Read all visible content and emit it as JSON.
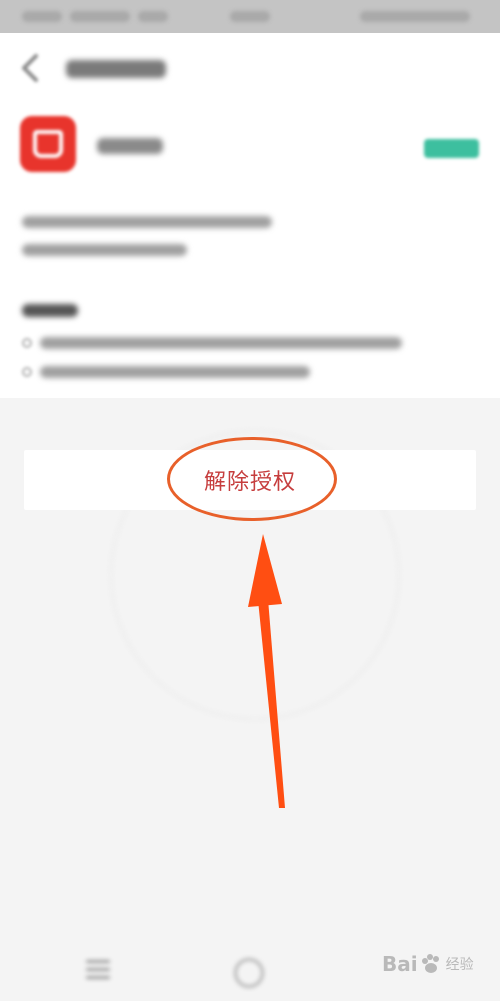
{
  "screen": {
    "revoke_button_label": "解除授权"
  },
  "watermark": {
    "text_left": "Bai",
    "text_right": "经验"
  },
  "colors": {
    "accent_red": "#c63d3d",
    "annotation_orange": "#e8602a",
    "app_icon_red": "#e8342c",
    "badge_green": "#3dbf9f"
  },
  "icons": [
    "back-arrow-icon",
    "app-logo-icon",
    "menu-icon",
    "home-icon",
    "baidu-paw-icon"
  ]
}
